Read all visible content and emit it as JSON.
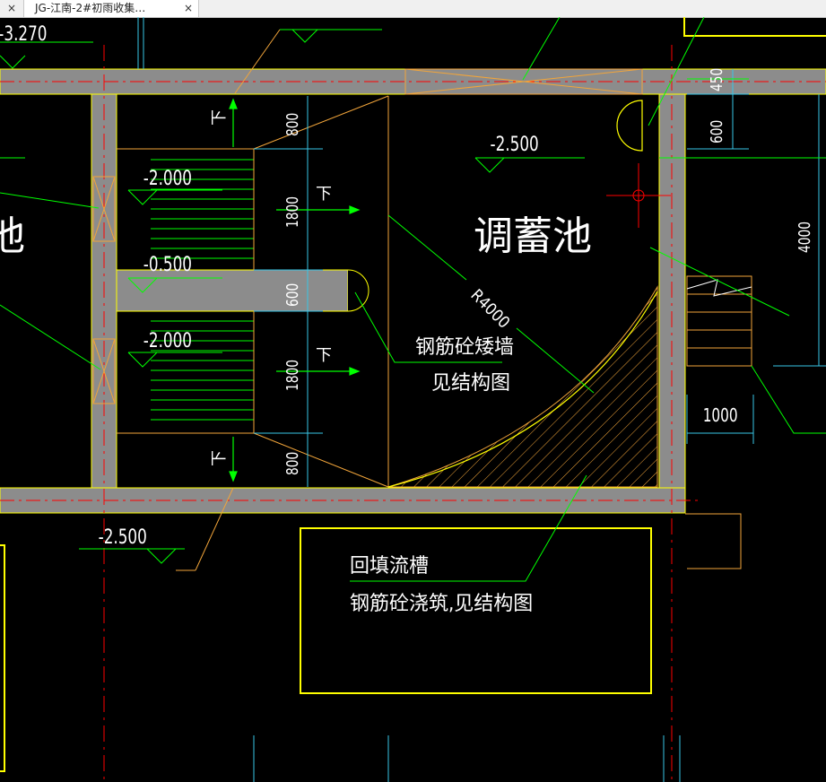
{
  "tab": {
    "title": "JG-江南-2#初雨收集…",
    "close": "×",
    "left_close": "×"
  },
  "drawing": {
    "elevations": [
      "-3.270",
      "-2.000",
      "-0.500",
      "-2.000",
      "-2.500",
      "-2.500"
    ],
    "dimensions": [
      "800",
      "1800",
      "600",
      "1800",
      "800",
      "450",
      "600",
      "4000",
      "1000"
    ],
    "room_label": "调蓄池",
    "left_label": "池",
    "radius_label": "R4000",
    "down_marks": [
      "下",
      "下",
      "下",
      "下"
    ],
    "note_wall": [
      "钢筋砼矮墙",
      "见结构图"
    ],
    "note_trough": [
      "回填流槽",
      "钢筋砼浇筑,见结构图"
    ]
  },
  "colors": {
    "wall": "#8c8c8c",
    "yellow": "#ffff00",
    "orange": "#f2a53a",
    "green": "#00ff00",
    "red": "#ff0000",
    "cyan": "#39c6e6",
    "white": "#ffffff"
  }
}
